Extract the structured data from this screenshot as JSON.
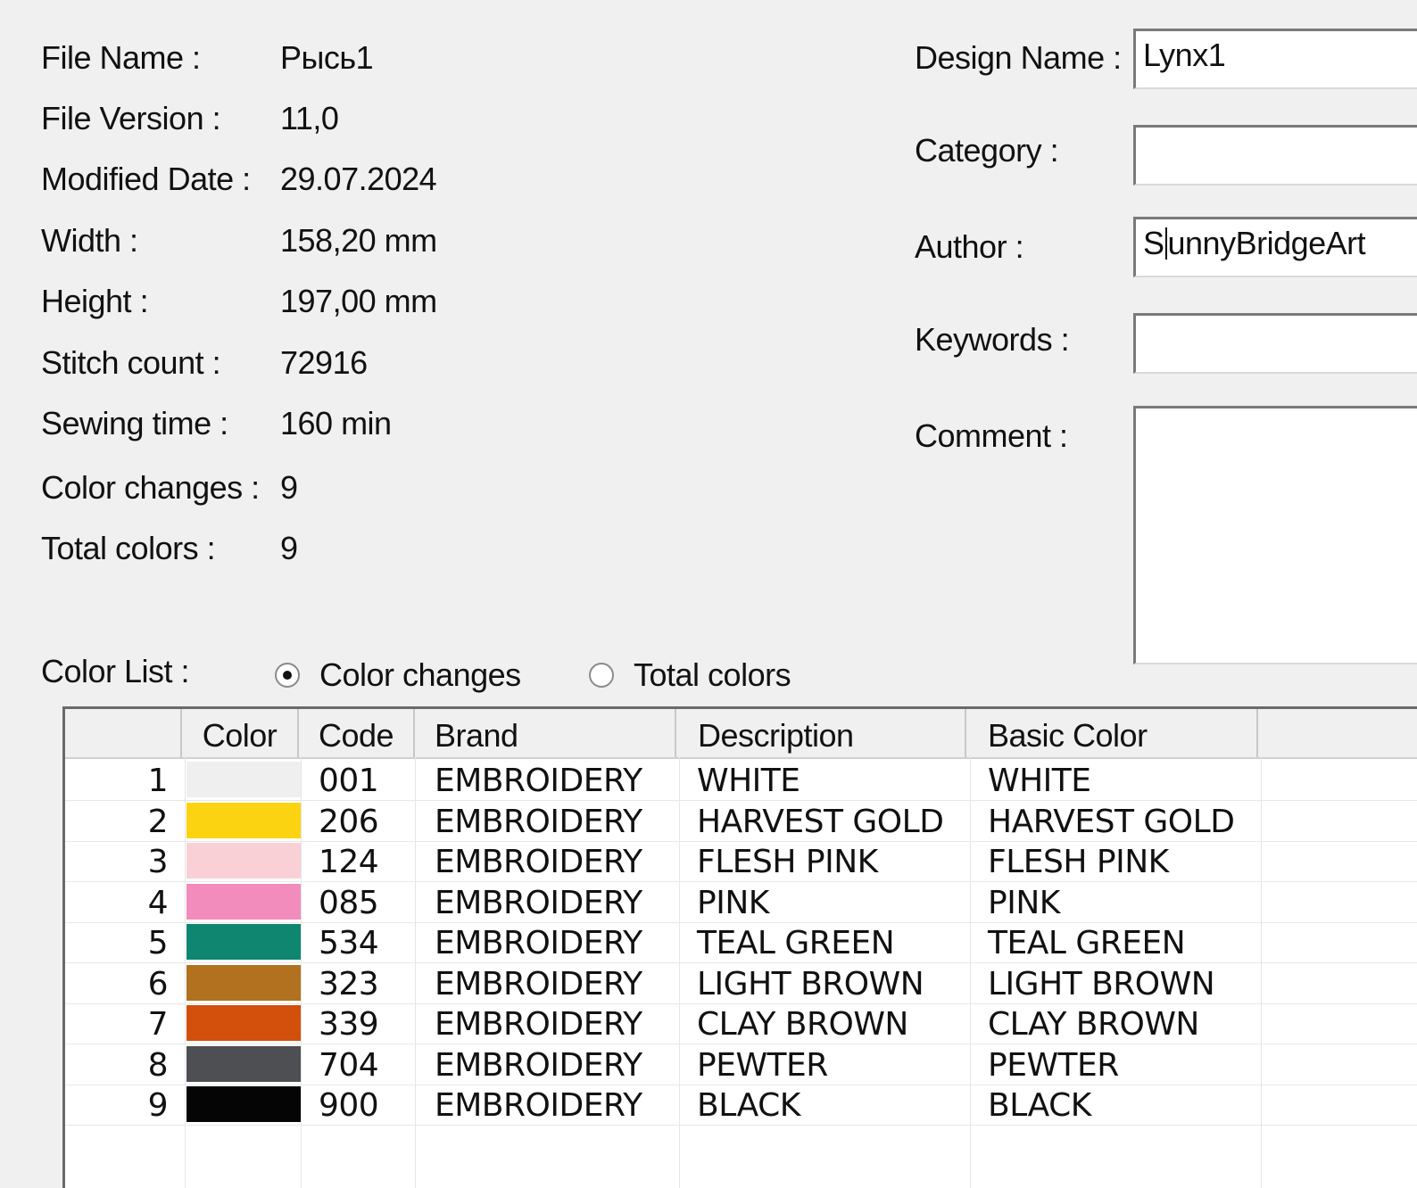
{
  "info": {
    "file_name_label": "File Name :",
    "file_name": "Рысь1",
    "file_version_label": "File Version :",
    "file_version": "11,0",
    "modified_date_label": "Modified Date :",
    "modified_date": "29.07.2024",
    "width_label": "Width :",
    "width": "158,20 mm",
    "height_label": "Height :",
    "height": "197,00 mm",
    "stitch_count_label": "Stitch count :",
    "stitch_count": "72916",
    "sewing_time_label": "Sewing time :",
    "sewing_time": "160 min",
    "color_changes_label": "Color changes :",
    "color_changes": "9",
    "total_colors_label": "Total colors :",
    "total_colors": "9"
  },
  "fields": {
    "design_name_label": "Design Name :",
    "design_name": "Lynx1",
    "category_label": "Category :",
    "category": "",
    "author_label": "Author :",
    "author_a": "S",
    "author_b": "unnyBridgeArt",
    "keywords_label": "Keywords :",
    "keywords": "",
    "comment_label": "Comment :",
    "comment": ""
  },
  "color_list": {
    "label": "Color List :",
    "option_changes": "Color changes",
    "option_total": "Total colors",
    "selected": "Color changes"
  },
  "table": {
    "headers": {
      "num": "",
      "color": "Color",
      "code": "Code",
      "brand": "Brand",
      "description": "Description",
      "basic": "Basic Color"
    },
    "rows": [
      {
        "num": "1",
        "swatch": "#efefef",
        "code": "001",
        "brand": "EMBROIDERY",
        "description": "WHITE",
        "basic": "WHITE"
      },
      {
        "num": "2",
        "swatch": "#fcd310",
        "code": "206",
        "brand": "EMBROIDERY",
        "description": "HARVEST GOLD",
        "basic": "HARVEST GOLD"
      },
      {
        "num": "3",
        "swatch": "#f9d0d6",
        "code": "124",
        "brand": "EMBROIDERY",
        "description": "FLESH PINK",
        "basic": "FLESH PINK"
      },
      {
        "num": "4",
        "swatch": "#f28cbc",
        "code": "085",
        "brand": "EMBROIDERY",
        "description": "PINK",
        "basic": "PINK"
      },
      {
        "num": "5",
        "swatch": "#0e8670",
        "code": "534",
        "brand": "EMBROIDERY",
        "description": "TEAL GREEN",
        "basic": "TEAL GREEN"
      },
      {
        "num": "6",
        "swatch": "#b1711f",
        "code": "323",
        "brand": "EMBROIDERY",
        "description": "LIGHT BROWN",
        "basic": "LIGHT BROWN"
      },
      {
        "num": "7",
        "swatch": "#d24f0c",
        "code": "339",
        "brand": "EMBROIDERY",
        "description": "CLAY BROWN",
        "basic": "CLAY BROWN"
      },
      {
        "num": "8",
        "swatch": "#4d4f52",
        "code": "704",
        "brand": "EMBROIDERY",
        "description": "PEWTER",
        "basic": "PEWTER"
      },
      {
        "num": "9",
        "swatch": "#050505",
        "code": "900",
        "brand": "EMBROIDERY",
        "description": "BLACK",
        "basic": "BLACK"
      }
    ]
  }
}
